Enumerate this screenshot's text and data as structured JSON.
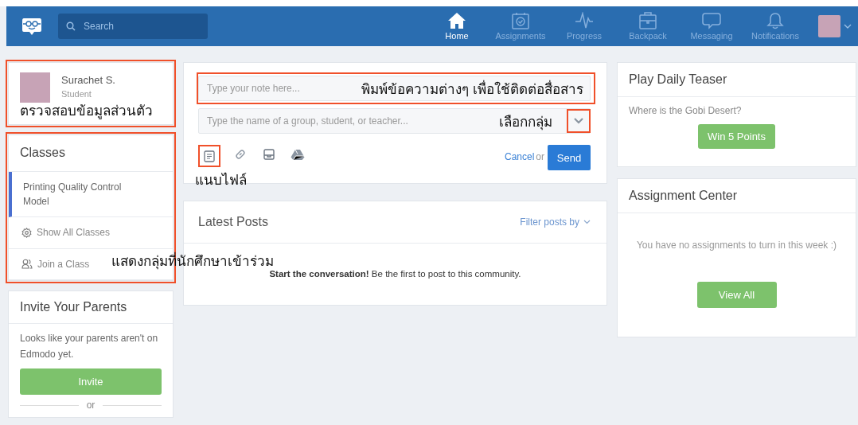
{
  "nav": {
    "search_placeholder": "Search",
    "items": [
      {
        "kind": "home",
        "label": "Home",
        "selected": true
      },
      {
        "kind": "assignments",
        "label": "Assignments",
        "selected": false
      },
      {
        "kind": "progress",
        "label": "Progress",
        "selected": false
      },
      {
        "kind": "backpack",
        "label": "Backpack",
        "selected": false
      },
      {
        "kind": "messaging",
        "label": "Messaging",
        "selected": false
      },
      {
        "kind": "notifications",
        "label": "Notifications",
        "selected": false
      }
    ]
  },
  "profile": {
    "name": "Surachet S.",
    "role": "Student",
    "annotation": "ตรวจสอบข้อมูลส่วนตัว"
  },
  "classes": {
    "title": "Classes",
    "items": [
      {
        "label": "Printing Quality Control Model",
        "selected": true
      }
    ],
    "links": [
      {
        "kind": "gear",
        "label": "Show All Classes"
      },
      {
        "kind": "people",
        "label": "Join a Class"
      }
    ],
    "annotation": "แสดงกลุ่มที่นักศึกษาเข้าร่วม"
  },
  "invite": {
    "title": "Invite Your Parents",
    "text": "Looks like your parents aren't on Edmodo yet.",
    "button": "Invite",
    "separator": "or"
  },
  "composer": {
    "note_placeholder": "Type your note here...",
    "note_annotation": "พิมพ์ข้อความต่างๆ เพื่อใช้ติดต่อสื่อสาร",
    "recipient_placeholder": "Type the name of a group, student, or teacher...",
    "recipient_annotation": "เลือกกลุ่ม",
    "attach_annotation": "แนบไฟล์",
    "cancel": "Cancel",
    "or": "or",
    "send": "Send"
  },
  "posts": {
    "title": "Latest Posts",
    "filter": "Filter posts by",
    "empty": "**Start the conversation!** Be the first to post to this community."
  },
  "teaser": {
    "title": "Play Daily Teaser",
    "question": "Where is the Gobi Desert?",
    "button": "Win 5 Points"
  },
  "assignment_center": {
    "title": "Assignment Center",
    "text": "You have no assignments to turn in this week :)",
    "button": "View All"
  }
}
